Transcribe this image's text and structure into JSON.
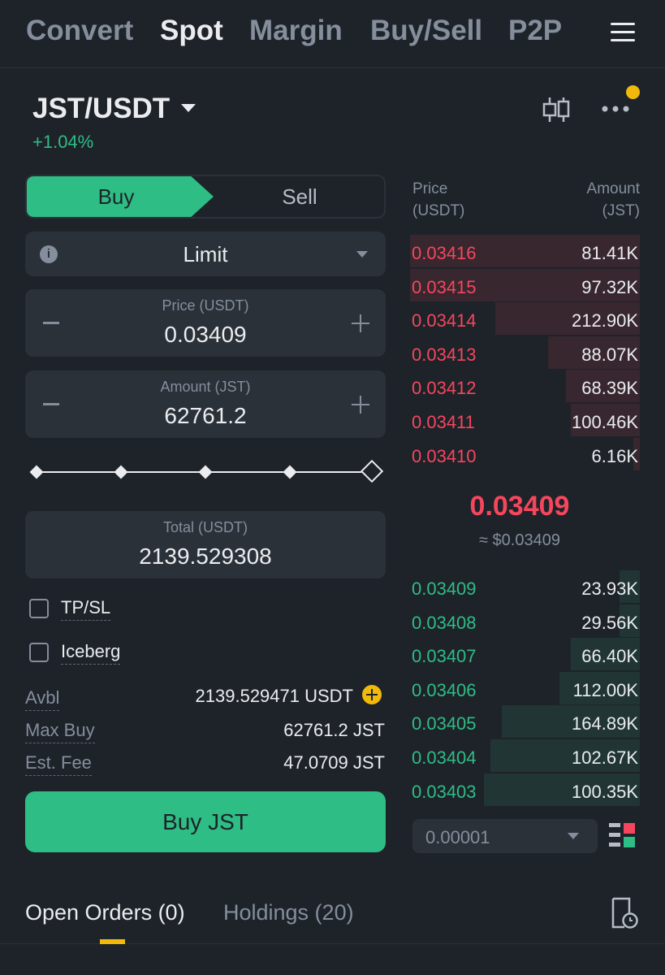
{
  "nav": {
    "tabs": [
      {
        "label": "Convert"
      },
      {
        "label": "Spot",
        "active": true
      },
      {
        "label": "Margin"
      },
      {
        "label": "Buy/Sell"
      },
      {
        "label": "P2P"
      }
    ],
    "menu_icon": "hamburger-icon"
  },
  "pair": {
    "symbol": "JST/USDT",
    "change": "+1.04%",
    "change_color": "#2ebd85"
  },
  "trade_form": {
    "buy_label": "Buy",
    "sell_label": "Sell",
    "order_type": "Limit",
    "price_label": "Price (USDT)",
    "price_value": "0.03409",
    "amount_label": "Amount (JST)",
    "amount_value": "62761.2",
    "slider_percent": 100,
    "total_label": "Total (USDT)",
    "total_value": "2139.529308",
    "tpsl_label": "TP/SL",
    "iceberg_label": "Iceberg",
    "avbl_label": "Avbl",
    "avbl_value": "2139.529471 USDT",
    "max_buy_label": "Max Buy",
    "max_buy_value": "62761.2 JST",
    "fee_label": "Est. Fee",
    "fee_value": "47.0709 JST",
    "submit_label": "Buy JST"
  },
  "orderbook": {
    "price_header": "Price",
    "price_unit": "(USDT)",
    "amount_header": "Amount",
    "amount_unit": "(JST)",
    "asks": [
      {
        "price": "0.03416",
        "amount": "81.41K",
        "depth": 1.0
      },
      {
        "price": "0.03415",
        "amount": "97.32K",
        "depth": 1.0
      },
      {
        "price": "0.03414",
        "amount": "212.90K",
        "depth": 0.63
      },
      {
        "price": "0.03413",
        "amount": "88.07K",
        "depth": 0.4
      },
      {
        "price": "0.03412",
        "amount": "68.39K",
        "depth": 0.32
      },
      {
        "price": "0.03411",
        "amount": "100.46K",
        "depth": 0.3
      },
      {
        "price": "0.03410",
        "amount": "6.16K",
        "depth": 0.03
      }
    ],
    "mid_price": "0.03409",
    "mid_fiat": "≈ $0.03409",
    "bids": [
      {
        "price": "0.03409",
        "amount": "23.93K",
        "depth": 0.09
      },
      {
        "price": "0.03408",
        "amount": "29.56K",
        "depth": 0.09
      },
      {
        "price": "0.03407",
        "amount": "66.40K",
        "depth": 0.3
      },
      {
        "price": "0.03406",
        "amount": "112.00K",
        "depth": 0.35
      },
      {
        "price": "0.03405",
        "amount": "164.89K",
        "depth": 0.6
      },
      {
        "price": "0.03404",
        "amount": "102.67K",
        "depth": 0.65
      },
      {
        "price": "0.03403",
        "amount": "100.35K",
        "depth": 0.68
      }
    ],
    "precision": "0.00001",
    "ask_color": "#f6465d",
    "bid_color": "#2ebd85"
  },
  "bottom_tabs": {
    "open_orders": "Open Orders (0)",
    "holdings": "Holdings (20)"
  }
}
